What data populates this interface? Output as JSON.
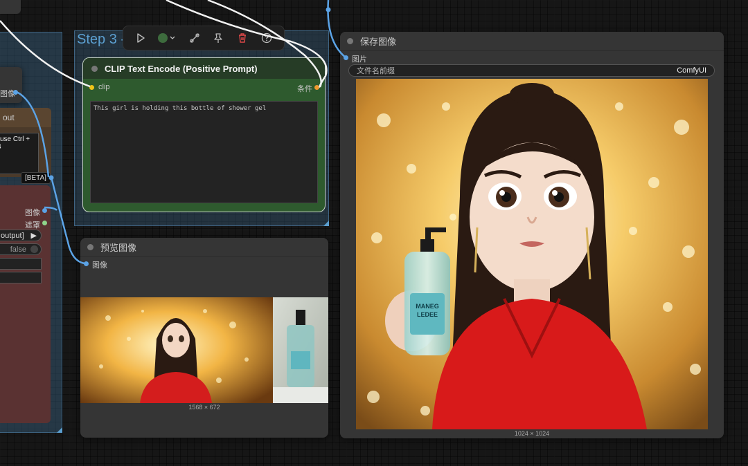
{
  "toolbar": {
    "run_icon": "play-icon",
    "color_icon": "color-circle-icon",
    "bypass_icon": "bypass-icon",
    "pin_icon": "pin-icon",
    "delete_icon": "trash-icon",
    "help_icon": "help-icon",
    "delete_color": "#e04848",
    "color_swatch": "#3d6b3d"
  },
  "group_step3": {
    "title": "Step 3 -"
  },
  "clip_node": {
    "title": "CLIP Text Encode (Positive Prompt)",
    "input_label": "clip",
    "output_label": "条件",
    "prompt_text": "This girl is holding this bottle of shower gel"
  },
  "left_nodes": {
    "node_a_output": "图像",
    "node_b_title": "out",
    "node_b_text": "l use Ctrl + B",
    "beta_badge": "[BETA]",
    "node_c_output_1": "图像",
    "node_c_output_2": "遮罩",
    "node_c_combo": "output]",
    "node_c_toggle": "false"
  },
  "preview_node": {
    "title": "预览图像",
    "input_label": "图像",
    "dimensions": "1568 × 672"
  },
  "save_node": {
    "title": "保存图像",
    "input_label": "图片",
    "prefix_label": "文件名前缀",
    "prefix_value": "ComfyUI",
    "dimensions": "1024 × 1024"
  }
}
